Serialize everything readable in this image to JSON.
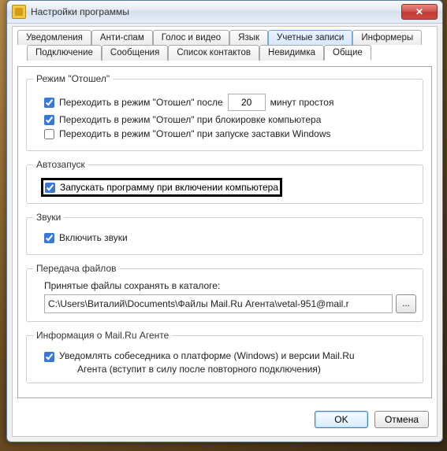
{
  "window": {
    "title": "Настройки программы"
  },
  "tabs_row1": [
    {
      "label": "Уведомления"
    },
    {
      "label": "Анти-спам"
    },
    {
      "label": "Голос и видео"
    },
    {
      "label": "Язык"
    },
    {
      "label": "Учетные записи"
    },
    {
      "label": "Информеры"
    }
  ],
  "tabs_row2": [
    {
      "label": "Подключение"
    },
    {
      "label": "Сообщения"
    },
    {
      "label": "Список контактов"
    },
    {
      "label": "Невидимка"
    },
    {
      "label": "Общие"
    }
  ],
  "away": {
    "legend": "Режим \"Отошел\"",
    "after_label_prefix": "Переходить в режим \"Отошел\" после",
    "after_minutes": "20",
    "after_label_suffix": "минут простоя",
    "on_lock_label": "Переходить в режим \"Отошел\" при блокировке компьютера",
    "on_screensaver_label": "Переходить в режим \"Отошел\" при запуске заставки Windows"
  },
  "autorun": {
    "legend": "Автозапуск",
    "label": "Запускать программу при включении компьютера"
  },
  "sounds": {
    "legend": "Звуки",
    "label": "Включить звуки"
  },
  "files": {
    "legend": "Передача файлов",
    "caption": "Принятые файлы сохранять в каталоге:",
    "path": "C:\\Users\\Виталий\\Documents\\Файлы Mail.Ru Агента\\vetal-951@mail.r",
    "browse_label": "..."
  },
  "info": {
    "legend": "Информация о Mail.Ru Агенте",
    "label_line1": "Уведомлять собеседника о платформе (Windows) и версии Mail.Ru",
    "label_line2": "Агента (вступит в силу после повторного подключения)"
  },
  "buttons": {
    "ok": "OK",
    "cancel": "Отмена"
  }
}
